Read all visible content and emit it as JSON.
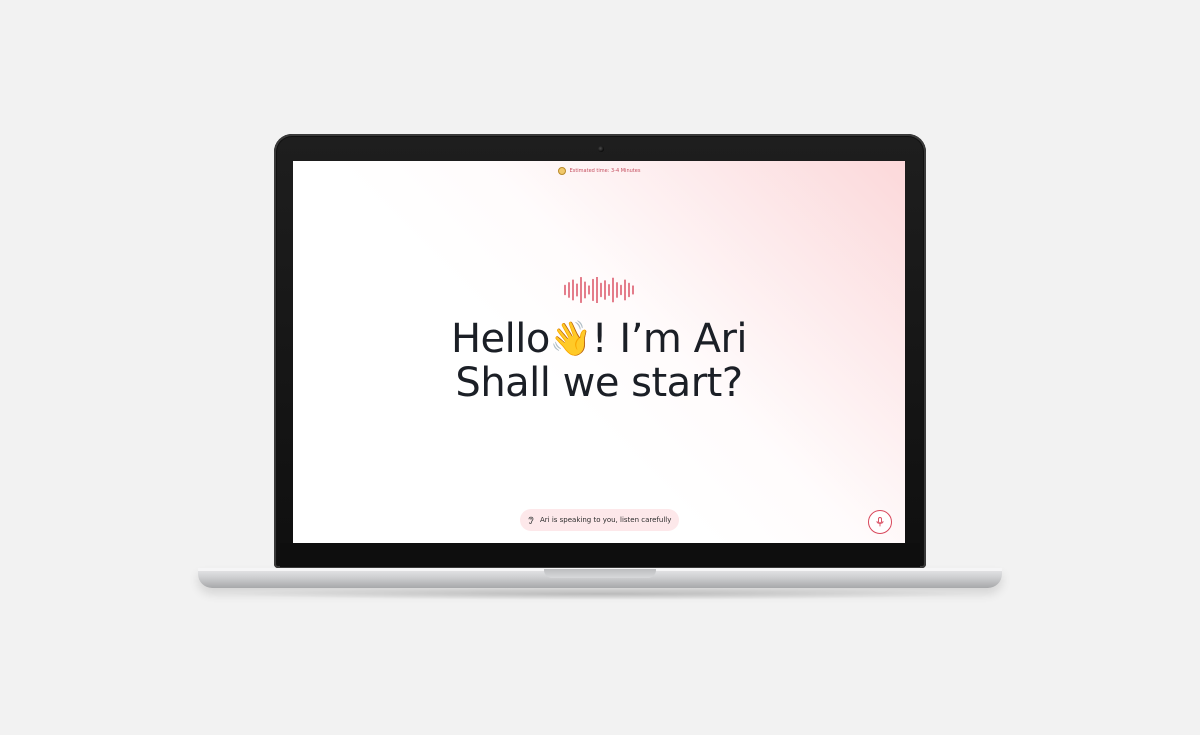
{
  "estimate": {
    "text": "Estimated time: 3-4 Minutes"
  },
  "headline": {
    "greeting": "Hello",
    "wave_emoji": "👋",
    "intro": "! I’m Ari",
    "question": "Shall we start?"
  },
  "status": {
    "text": "Ari is speaking to you, listen carefully"
  },
  "icons": {
    "estimate": "avatar-face-icon",
    "waveform": "audio-waveform-icon",
    "ear": "ear-icon",
    "mic": "microphone-icon"
  },
  "colors": {
    "accent": "#d8475b",
    "pill_bg": "#fde8ea",
    "text": "#1b1f26"
  },
  "waveform_levels": [
    0.35,
    0.55,
    0.75,
    0.45,
    0.95,
    0.6,
    0.3,
    0.8,
    1.0,
    0.5,
    0.7,
    0.4,
    0.9,
    0.55,
    0.35,
    0.75,
    0.5,
    0.3
  ]
}
